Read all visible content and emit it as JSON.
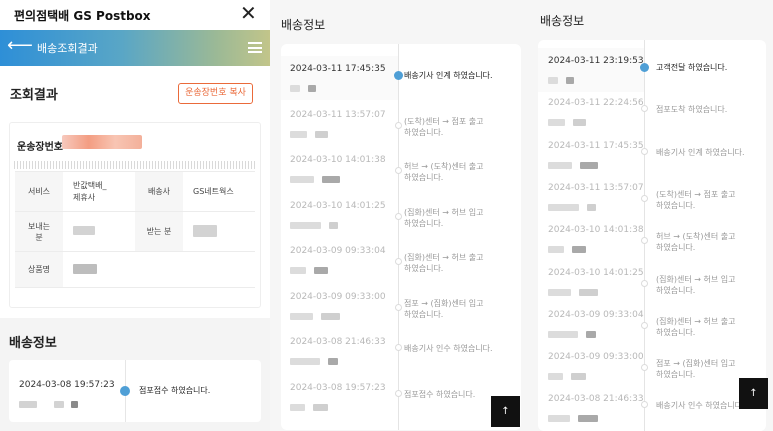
{
  "panel1": {
    "app_title": "편의점택배 GS Postbox",
    "close_icon": "close-icon",
    "nav": {
      "back_icon": "back-arrow-icon",
      "title": "배송조회결과",
      "menu_icon": "hamburger-menu-icon"
    },
    "result": {
      "title": "조회결과",
      "copy_button": "운송장번호 복사",
      "waybill_label": "운송장번호",
      "table": {
        "service_label": "서비스",
        "service_value": "반값택배_\n제휴사",
        "courier_label": "배송사",
        "courier_value": "GS네트웍스",
        "sender_label": "보내는\n분",
        "receiver_label": "받는 분",
        "product_label": "상품명"
      }
    },
    "delivery": {
      "title": "배송정보",
      "entries": [
        {
          "time": "2024-03-08 19:57:23",
          "status": "점포접수 하였습니다."
        }
      ]
    }
  },
  "panel2": {
    "title": "배송정보",
    "top_button": "↑",
    "entries": [
      {
        "time": "2024-03-11 17:45:35",
        "status": "배송기사 인계 하였습니다.",
        "active": true
      },
      {
        "time": "2024-03-11 13:57:07",
        "status": "(도착)센터 → 점포 출고\n하였습니다.",
        "active": false
      },
      {
        "time": "2024-03-10 14:01:38",
        "status": "허브 → (도착)센터 출고\n하였습니다.",
        "active": false
      },
      {
        "time": "2024-03-10 14:01:25",
        "status": "(집화)센터 → 허브 입고\n하였습니다.",
        "active": false
      },
      {
        "time": "2024-03-09 09:33:04",
        "status": "(집화)센터 → 허브 출고\n하였습니다.",
        "active": false
      },
      {
        "time": "2024-03-09 09:33:00",
        "status": "점포 → (집화)센터 입고\n하였습니다.",
        "active": false
      },
      {
        "time": "2024-03-08 21:46:33",
        "status": "배송기사 인수 하였습니다.",
        "active": false
      },
      {
        "time": "2024-03-08 19:57:23",
        "status": "점포접수 하였습니다.",
        "active": false
      }
    ]
  },
  "panel3": {
    "title": "배송정보",
    "top_button": "↑",
    "entries": [
      {
        "time": "2024-03-11 23:19:53",
        "status": "고객전달 하였습니다.",
        "active": true
      },
      {
        "time": "2024-03-11 22:24:56",
        "status": "점포도착 하였습니다.",
        "active": false
      },
      {
        "time": "2024-03-11 17:45:35",
        "status": "배송기사 인계 하였습니다.",
        "active": false
      },
      {
        "time": "2024-03-11 13:57:07",
        "status": "(도착)센터 → 점포 출고\n하였습니다.",
        "active": false
      },
      {
        "time": "2024-03-10 14:01:38",
        "status": "허브 → (도착)센터 출고\n하였습니다.",
        "active": false
      },
      {
        "time": "2024-03-10 14:01:25",
        "status": "(집화)센터 → 허브 입고\n하였습니다.",
        "active": false
      },
      {
        "time": "2024-03-09 09:33:04",
        "status": "(집화)센터 → 허브 출고\n하였습니다.",
        "active": false
      },
      {
        "time": "2024-03-09 09:33:00",
        "status": "점포 → (집화)센터 입고\n하였습니다.",
        "active": false
      },
      {
        "time": "2024-03-08 21:46:33",
        "status": "배송기사 인수 하였습니다.",
        "active": false
      }
    ]
  },
  "colors": {
    "accent": "#ea6a3a",
    "dot_active": "#4f9fd6",
    "nav_start": "#2e8fd7",
    "nav_end": "#c2c58a"
  }
}
